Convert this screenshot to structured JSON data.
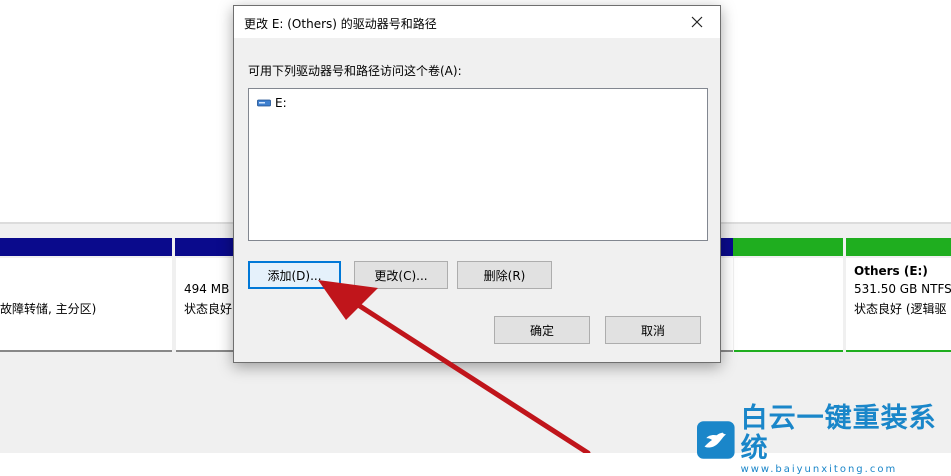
{
  "dialog": {
    "title": "更改 E: (Others) 的驱动器号和路径",
    "prompt": "可用下列驱动器号和路径访问这个卷(A):",
    "list_items": [
      {
        "label": "E:",
        "icon": "drive-icon"
      }
    ],
    "buttons": {
      "add": "添加(D)...",
      "change": "更改(C)...",
      "remove": "删除(R)",
      "ok": "确定",
      "cancel": "取消"
    }
  },
  "background": {
    "partitions": [
      {
        "line1": "",
        "line2": "故障转储, 主分区)"
      },
      {
        "line1": "494 MB",
        "line2": "状态良好"
      },
      {
        "line1": "Others (E:)",
        "line2": "531.50 GB NTFS",
        "line3": "状态良好 (逻辑驱"
      }
    ]
  },
  "watermark": {
    "brand": "白云一键重装系统",
    "url": "www.baiyunxitong.com"
  },
  "colors": {
    "accent_blue": "#0078d7",
    "arrow_red": "#c0151b",
    "partition_primary": "#0a0a8c",
    "partition_logical": "#1fae1f",
    "watermark_blue": "#1a86c9"
  }
}
